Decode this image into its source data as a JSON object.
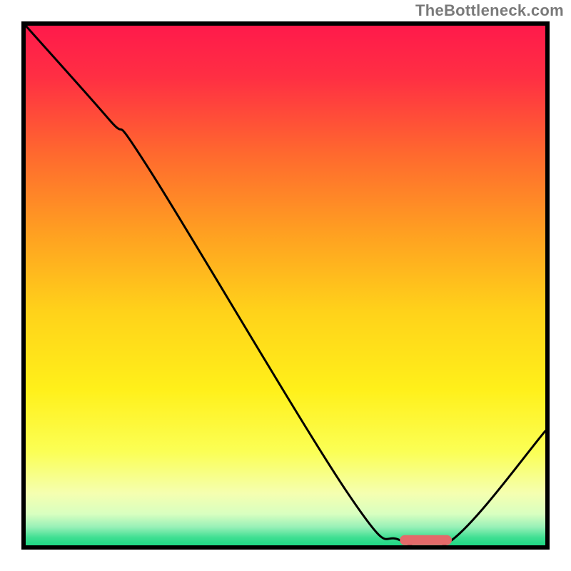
{
  "watermark": "TheBottleneck.com",
  "chart_data": {
    "type": "line",
    "title": "",
    "xlabel": "",
    "ylabel": "",
    "xlim": [
      0,
      100
    ],
    "ylim": [
      0,
      100
    ],
    "series": [
      {
        "name": "curve",
        "x": [
          0,
          16,
          24,
          62,
          72,
          82,
          100
        ],
        "y": [
          100,
          82,
          72,
          10,
          1,
          1,
          22
        ]
      }
    ],
    "marker": {
      "name": "highlight-bar",
      "x_start": 72,
      "x_end": 82,
      "y": 1,
      "color": "#e46a6a"
    },
    "gradient_stops": [
      {
        "offset": 0.0,
        "color": "#ff1a4b"
      },
      {
        "offset": 0.1,
        "color": "#ff2f43"
      },
      {
        "offset": 0.25,
        "color": "#ff6a2e"
      },
      {
        "offset": 0.4,
        "color": "#ffa021"
      },
      {
        "offset": 0.55,
        "color": "#ffd21a"
      },
      {
        "offset": 0.7,
        "color": "#fff01a"
      },
      {
        "offset": 0.82,
        "color": "#fbff55"
      },
      {
        "offset": 0.9,
        "color": "#f5ffb0"
      },
      {
        "offset": 0.94,
        "color": "#d8ffc0"
      },
      {
        "offset": 0.965,
        "color": "#97f0b7"
      },
      {
        "offset": 0.985,
        "color": "#3fdf92"
      },
      {
        "offset": 1.0,
        "color": "#1fd885"
      }
    ],
    "line_color": "#000000",
    "line_width": 3
  }
}
